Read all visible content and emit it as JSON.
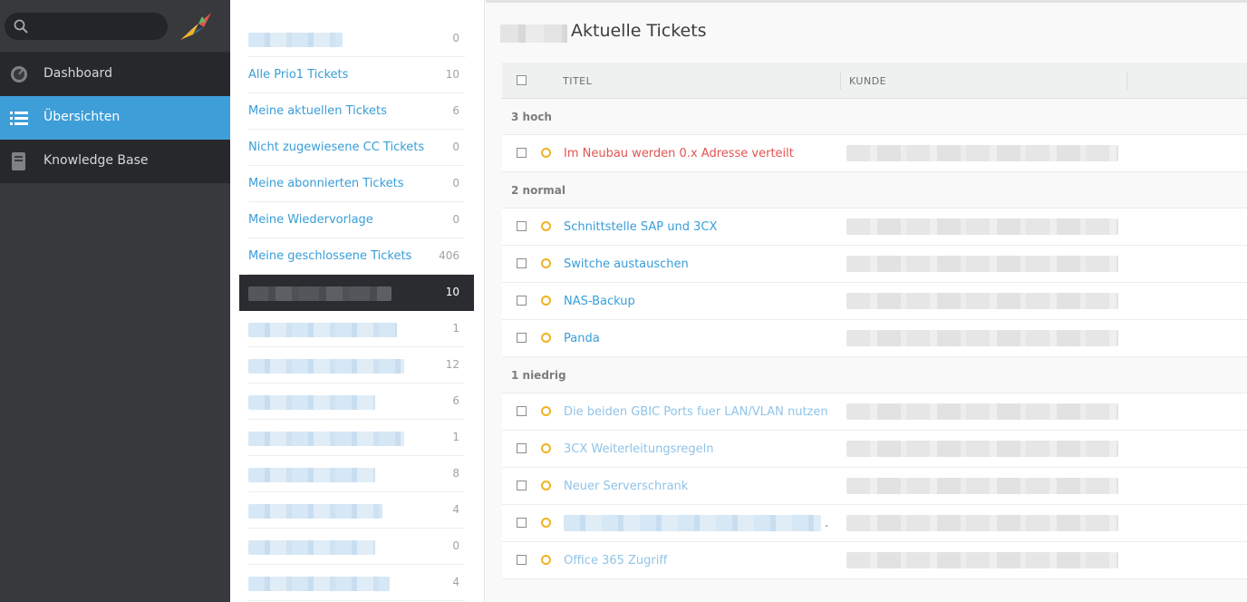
{
  "nav": {
    "search_placeholder": "",
    "items": [
      {
        "label": "Dashboard",
        "icon": "dashboard-icon"
      },
      {
        "label": "Übersichten",
        "icon": "list-icon"
      },
      {
        "label": "Knowledge Base",
        "icon": "book-icon"
      }
    ]
  },
  "overviews": [
    {
      "label": "",
      "count": "0"
    },
    {
      "label": "Alle Prio1 Tickets",
      "count": "10"
    },
    {
      "label": "Meine aktuellen Tickets",
      "count": "6"
    },
    {
      "label": "Nicht zugewiesene CC Tickets",
      "count": "0"
    },
    {
      "label": "Meine abonnierten Tickets",
      "count": "0"
    },
    {
      "label": "Meine Wiedervorlage",
      "count": "0"
    },
    {
      "label": "Meine geschlossene Tickets",
      "count": "406"
    },
    {
      "label": "",
      "count": "10"
    },
    {
      "label": "",
      "count": "1"
    },
    {
      "label": "",
      "count": "12"
    },
    {
      "label": "",
      "count": "6"
    },
    {
      "label": "",
      "count": "1"
    },
    {
      "label": "",
      "count": "8"
    },
    {
      "label": "",
      "count": "4"
    },
    {
      "label": "",
      "count": "0"
    },
    {
      "label": "",
      "count": "4"
    }
  ],
  "main": {
    "title": "Aktuelle Tickets",
    "columns": {
      "title": "TITEL",
      "customer": "KUNDE"
    },
    "groups": [
      {
        "label": "3 hoch",
        "tickets": [
          {
            "title": "Im Neubau werden 0.x Adresse verteilt",
            "style": "red"
          }
        ]
      },
      {
        "label": "2 normal",
        "tickets": [
          {
            "title": "Schnittstelle SAP und 3CX",
            "style": "blue"
          },
          {
            "title": "Switche austauschen",
            "style": "blue"
          },
          {
            "title": "NAS-Backup",
            "style": "blue"
          },
          {
            "title": "Panda",
            "style": "blue"
          }
        ]
      },
      {
        "label": "1 niedrig",
        "tickets": [
          {
            "title": "Die beiden GBIC Ports fuer LAN/VLAN nutzen",
            "style": "light"
          },
          {
            "title": "3CX Weiterleitungsregeln",
            "style": "light"
          },
          {
            "title": "Neuer Serverschrank",
            "style": "light"
          },
          {
            "title": "",
            "style": "light",
            "suffix": "."
          },
          {
            "title": "Office 365 Zugriff",
            "style": "light"
          }
        ]
      }
    ]
  },
  "colors": {
    "accent": "#3e9ed8",
    "nav_bg": "#38393d",
    "prio": "#f0b323",
    "red": "#e25450",
    "link": "#389ed7"
  }
}
